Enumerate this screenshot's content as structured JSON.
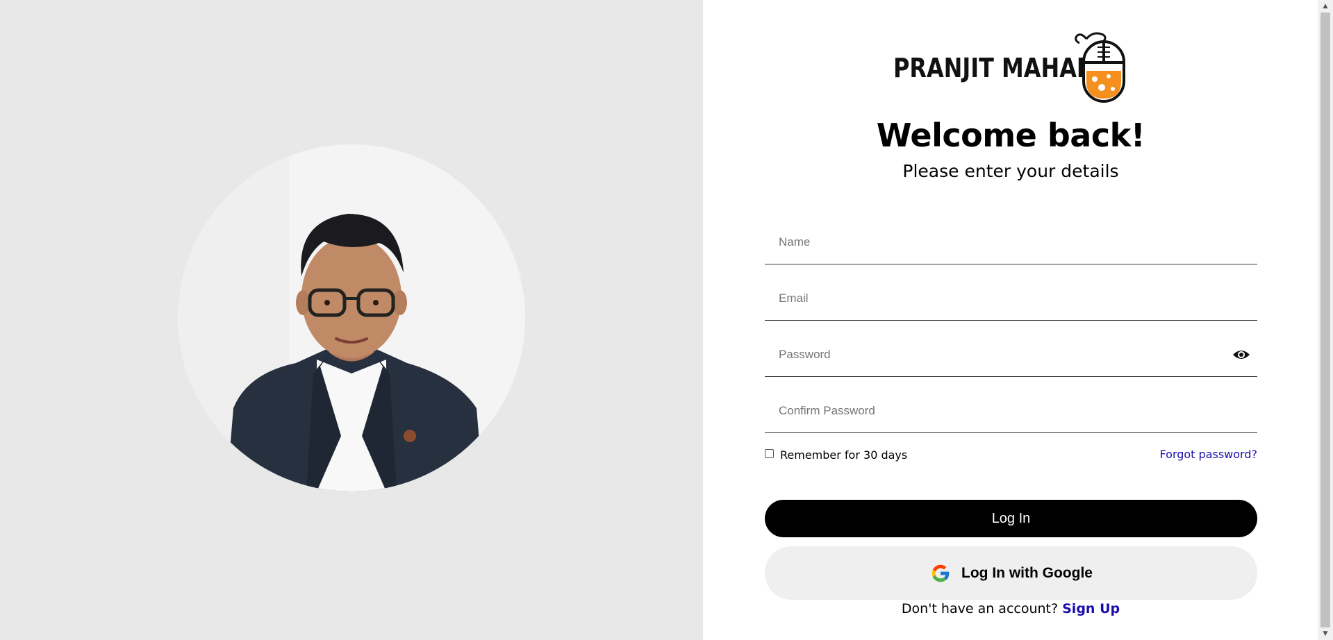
{
  "brand": {
    "name": "PRANJIT MAHANTA",
    "logo_icon": "mouse-flask-icon",
    "accent_color": "#f5901e"
  },
  "hero": {
    "portrait_icon": "profile-portrait"
  },
  "form": {
    "title": "Welcome back!",
    "subtitle": "Please enter your details",
    "name_placeholder": "Name",
    "email_placeholder": "Email",
    "password_placeholder": "Password",
    "confirm_placeholder": "Confirm Password",
    "password_toggle_icon": "eye-icon",
    "remember_label": "Remember for 30 days",
    "remember_checked": false,
    "forgot_label": "Forgot password?",
    "login_label": "Log In",
    "google_label": "Log In with Google",
    "google_icon": "google-icon",
    "signup_prompt": "Don't have an account?",
    "signup_label": "Sign Up"
  },
  "colors": {
    "left_background": "#e8e8e8",
    "link": "#1a0dab",
    "primary_button": "#000000",
    "secondary_button": "#efefef"
  }
}
